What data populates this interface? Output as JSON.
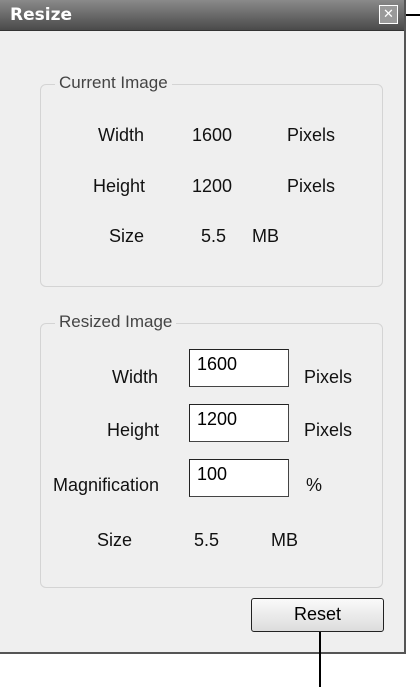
{
  "window": {
    "title": "Resize",
    "close_glyph": "✕"
  },
  "current_image": {
    "legend": "Current Image",
    "width": {
      "label": "Width",
      "value": "1600",
      "unit": "Pixels"
    },
    "height": {
      "label": "Height",
      "value": "1200",
      "unit": "Pixels"
    },
    "size": {
      "label": "Size",
      "value": "5.5",
      "unit": "MB"
    }
  },
  "resized_image": {
    "legend": "Resized Image",
    "width": {
      "label": "Width",
      "value": "1600",
      "unit": "Pixels"
    },
    "height": {
      "label": "Height",
      "value": "1200",
      "unit": "Pixels"
    },
    "magnification": {
      "label": "Magnification",
      "value": "100",
      "unit": "%"
    },
    "size": {
      "label": "Size",
      "value": "5.5",
      "unit": "MB"
    }
  },
  "buttons": {
    "reset_label": "Reset"
  },
  "icons": {
    "close": "close-icon"
  }
}
